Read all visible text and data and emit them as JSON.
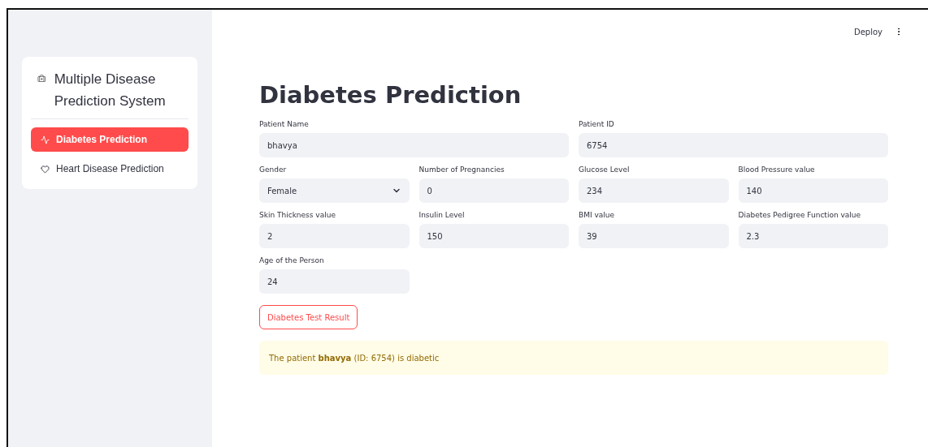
{
  "toolbar": {
    "deploy": "Deploy"
  },
  "sidebar": {
    "title": "Multiple Disease Prediction System",
    "items": [
      {
        "label": "Diabetes Prediction",
        "selected": true
      },
      {
        "label": "Heart Disease Prediction",
        "selected": false
      }
    ]
  },
  "main": {
    "title": "Diabetes Prediction",
    "patient_fields": [
      {
        "kind": "text",
        "label": "Patient Name",
        "value": "bhavya"
      },
      {
        "kind": "text",
        "label": "Patient ID",
        "value": "6754"
      }
    ],
    "fields": [
      {
        "kind": "select",
        "label": "Gender",
        "value": "Female"
      },
      {
        "kind": "text",
        "label": "Number of Pregnancies",
        "value": "0"
      },
      {
        "kind": "text",
        "label": "Glucose Level",
        "value": "234"
      },
      {
        "kind": "text",
        "label": "Blood Pressure value",
        "value": "140"
      },
      {
        "kind": "text",
        "label": "Skin Thickness value",
        "value": "2"
      },
      {
        "kind": "text",
        "label": "Insulin Level",
        "value": "150"
      },
      {
        "kind": "text",
        "label": "BMI value",
        "value": "39"
      },
      {
        "kind": "text",
        "label": "Diabetes Pedigree Function value",
        "value": "2.3"
      },
      {
        "kind": "text",
        "label": "Age of the Person",
        "value": "24"
      }
    ],
    "button": "Diabetes Test Result",
    "result": "The patient **bhavya** (ID: 6754) is diabetic"
  }
}
